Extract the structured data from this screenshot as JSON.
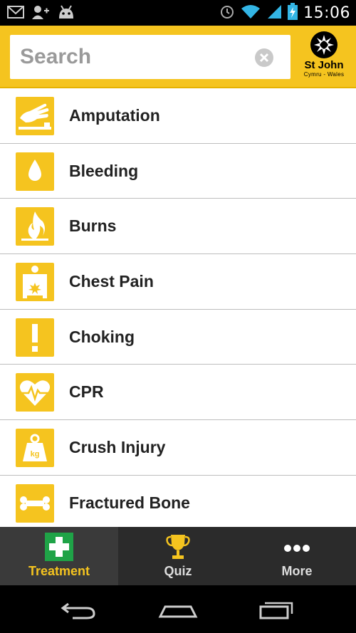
{
  "status_bar": {
    "time": "15:06",
    "icons": [
      "gmail-icon",
      "add-contact-icon",
      "android-icon",
      "alarm-icon",
      "wifi-icon",
      "signal-icon",
      "battery-charging-icon"
    ]
  },
  "header": {
    "search_placeholder": "Search",
    "logo": {
      "name": "St John",
      "sub": "Cymru - Wales"
    }
  },
  "list": {
    "items": [
      {
        "label": "Amputation",
        "icon": "hand-icon"
      },
      {
        "label": "Bleeding",
        "icon": "drop-icon"
      },
      {
        "label": "Burns",
        "icon": "flame-icon"
      },
      {
        "label": "Chest Pain",
        "icon": "chest-pain-icon"
      },
      {
        "label": "Choking",
        "icon": "exclamation-icon"
      },
      {
        "label": "CPR",
        "icon": "heart-pulse-icon"
      },
      {
        "label": "Crush Injury",
        "icon": "weight-icon"
      },
      {
        "label": "Fractured Bone",
        "icon": "bone-icon"
      }
    ]
  },
  "tabs": [
    {
      "label": "Treatment",
      "icon": "first-aid-icon",
      "active": true
    },
    {
      "label": "Quiz",
      "icon": "trophy-icon",
      "active": false
    },
    {
      "label": "More",
      "icon": "more-dots-icon",
      "active": false
    }
  ],
  "weight_icon_text": "kg",
  "colors": {
    "accent": "#f5c41f",
    "tab_bar": "#2b2b2b",
    "first_aid_green": "#1fa347"
  }
}
